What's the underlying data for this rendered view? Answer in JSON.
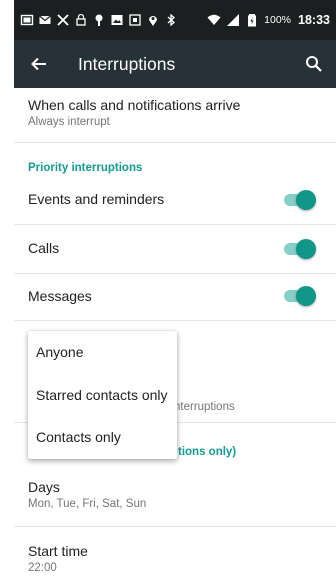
{
  "status_bar": {
    "battery": "100%",
    "time": "18:33"
  },
  "toolbar": {
    "title": "Interruptions",
    "back_icon": "arrow-back-icon",
    "search_icon": "search-icon"
  },
  "when_calls": {
    "title": "When calls and notifications arrive",
    "subtitle": "Always interrupt"
  },
  "priority_section": {
    "header": "Priority interruptions",
    "items": [
      {
        "label": "Events and reminders",
        "enabled": true
      },
      {
        "label": "Calls",
        "enabled": true
      },
      {
        "label": "Messages",
        "enabled": true
      }
    ]
  },
  "partially_hidden": {
    "subtitle_fragment": "nterruptions",
    "header_fragment_1": "(",
    "header_fragment_2": "tions only)"
  },
  "days": {
    "title": "Days",
    "subtitle": "Mon, Tue, Fri, Sat, Sun"
  },
  "start_time": {
    "title": "Start time",
    "subtitle": "22:00"
  },
  "popup_menu": {
    "options": [
      "Anyone",
      "Starred contacts only",
      "Contacts only"
    ]
  },
  "colors": {
    "accent": "#0f9688",
    "toolbar": "#273238",
    "status_bar": "#1c1f1f"
  }
}
